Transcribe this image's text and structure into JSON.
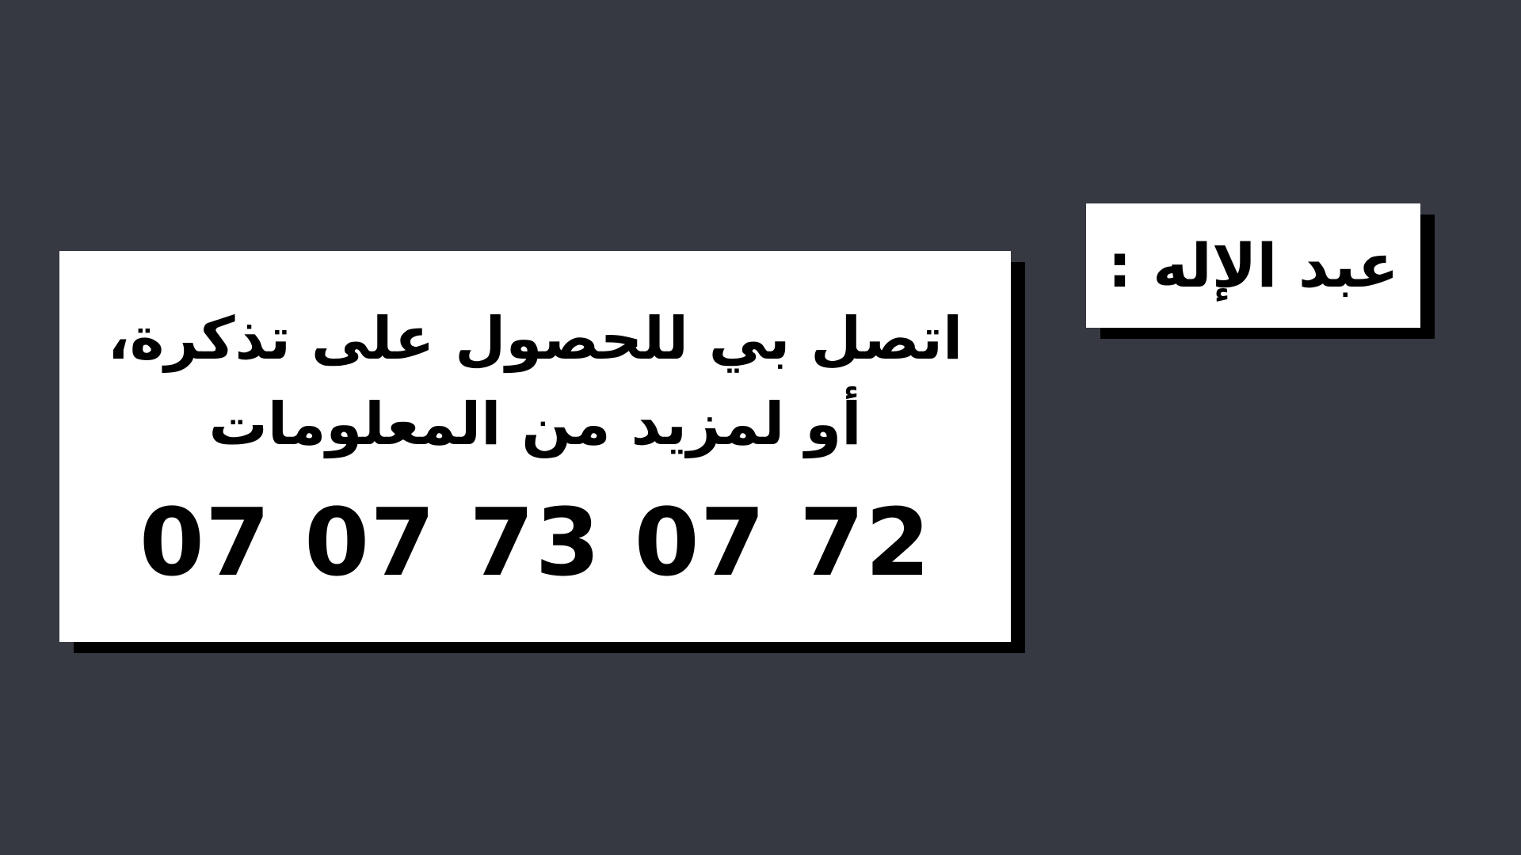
{
  "name_card": {
    "text": "عبد الإله :"
  },
  "message_card": {
    "line_1": "اتصل بي للحصول على تذكرة،",
    "line_2": "أو لمزيد من المعلومات",
    "phone": "07 07 73 07 72"
  },
  "colors": {
    "background": "#363941",
    "card": "#ffffff",
    "shadow": "#000000",
    "text": "#000000"
  }
}
